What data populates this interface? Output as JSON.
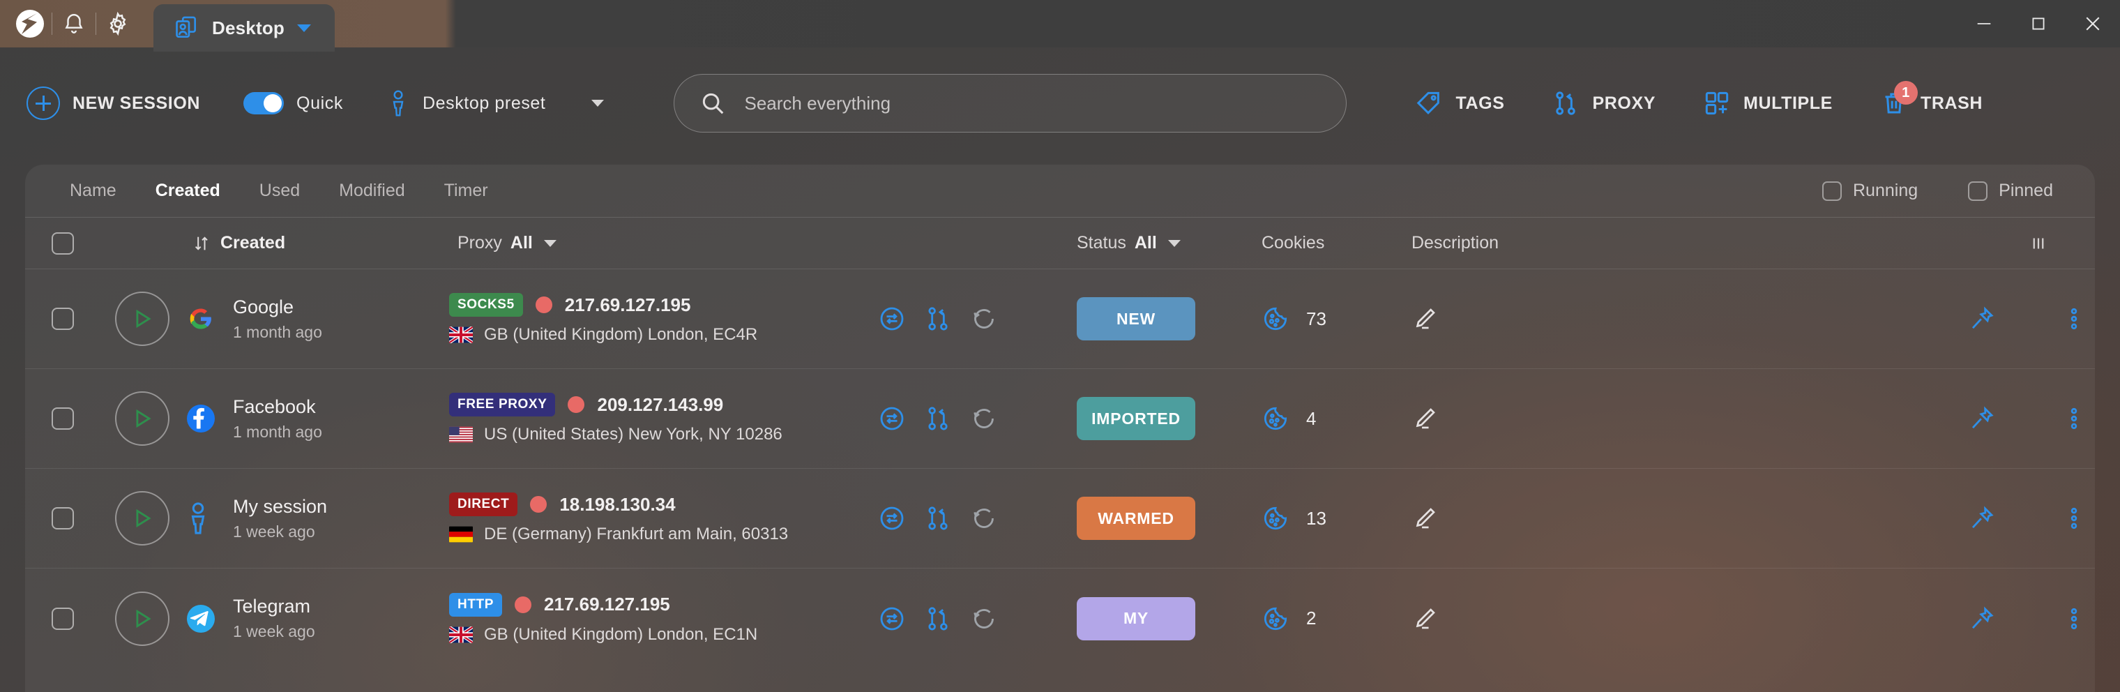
{
  "titlebar": {
    "app_icon": "app-logo-icon",
    "notifications_icon": "bell-icon",
    "settings_icon": "gear-icon",
    "tab": {
      "icon": "profiles-icon",
      "title": "Desktop",
      "dropdown_icon": "chevron-down-icon"
    },
    "window_controls": {
      "minimize": "minimize-icon",
      "maximize": "maximize-icon",
      "close": "close-icon"
    }
  },
  "toolbar": {
    "new_session_label": "NEW SESSION",
    "quick_label": "Quick",
    "quick_enabled": true,
    "preset_label": "Desktop preset",
    "search_placeholder": "Search everything",
    "search_value": "",
    "tags_label": "TAGS",
    "proxy_label": "PROXY",
    "multiple_label": "MULTIPLE",
    "trash_label": "TRASH",
    "trash_badge": "1"
  },
  "filterbar": {
    "sort_tabs": [
      {
        "label": "Name",
        "active": false
      },
      {
        "label": "Created",
        "active": true
      },
      {
        "label": "Used",
        "active": false
      },
      {
        "label": "Modified",
        "active": false
      },
      {
        "label": "Timer",
        "active": false
      }
    ],
    "running_label": "Running",
    "running_checked": false,
    "pinned_label": "Pinned",
    "pinned_checked": false
  },
  "table": {
    "headers": {
      "sort_icon": "sort-updown-icon",
      "created": "Created",
      "proxy": "Proxy",
      "proxy_filter": "All",
      "status": "Status",
      "status_filter": "All",
      "cookies": "Cookies",
      "description": "Description",
      "columns_icon": "columns-icon"
    },
    "rows": [
      {
        "name": "Google",
        "favicon": "google-icon",
        "created": "1 month ago",
        "proxy_type": "SOCKS5",
        "proxy_type_color": "#3d8a4d",
        "ip": "217.69.127.195",
        "flag": "gb",
        "geo": "GB (United Kingdom) London, EC4R",
        "status": "NEW",
        "status_color": "#5b94bf",
        "cookies": "73"
      },
      {
        "name": "Facebook",
        "favicon": "facebook-icon",
        "created": "1 month ago",
        "proxy_type": "FREE PROXY",
        "proxy_type_color": "#332f7a",
        "ip": "209.127.143.99",
        "flag": "us",
        "geo": "US (United States) New York, NY 10286",
        "status": "IMPORTED",
        "status_color": "#4d9e9e",
        "cookies": "4"
      },
      {
        "name": "My session",
        "favicon": "person-icon",
        "created": "1 week ago",
        "proxy_type": "DIRECT",
        "proxy_type_color": "#9e1b1b",
        "ip": "18.198.130.34",
        "flag": "de",
        "geo": "DE (Germany) Frankfurt am Main, 60313",
        "status": "WARMED",
        "status_color": "#d97845",
        "cookies": "13"
      },
      {
        "name": "Telegram",
        "favicon": "telegram-icon",
        "created": "1 week ago",
        "proxy_type": "HTTP",
        "proxy_type_color": "#2e8fe8",
        "ip": "217.69.127.195",
        "flag": "gb",
        "geo": "GB (United Kingdom) London, EC1N",
        "status": "MY",
        "status_color": "#b3a6e8",
        "cookies": "2"
      }
    ],
    "row_icons": {
      "transfer": "transfer-icon",
      "branch": "proxy-branch-icon",
      "refresh": "refresh-icon",
      "cookie": "cookie-icon",
      "edit": "pencil-icon",
      "pin": "pin-icon",
      "more": "more-vertical-icon"
    }
  },
  "theme": {
    "accent": "#2e8fe8",
    "text": "#f0eeee",
    "muted": "#bdb9b9"
  }
}
